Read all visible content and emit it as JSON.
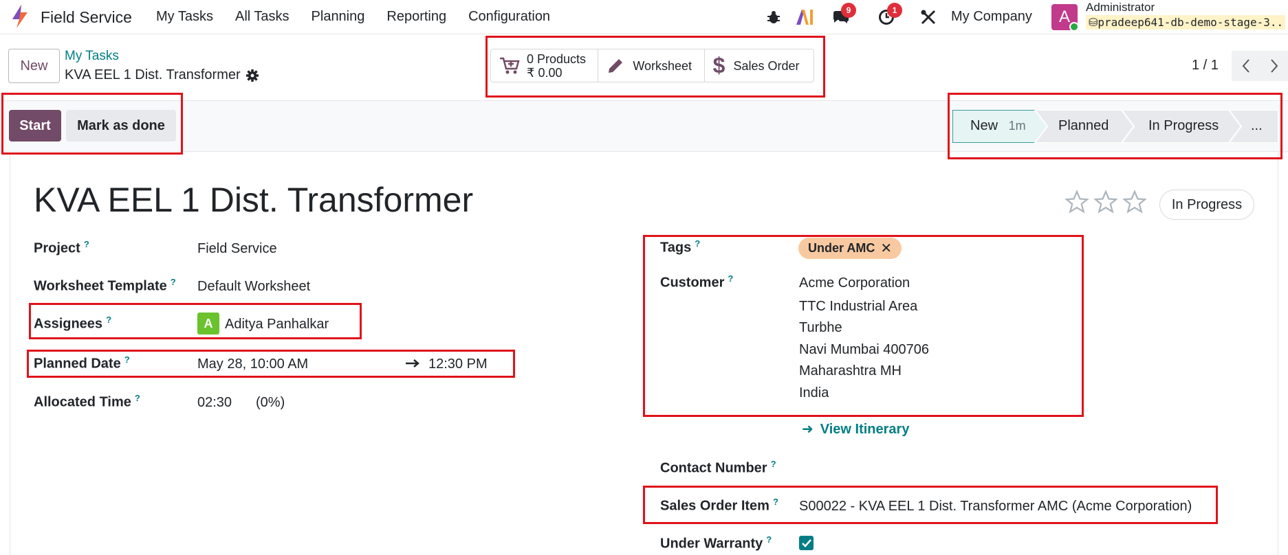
{
  "topbar": {
    "app_name": "Field Service",
    "menu": [
      "My Tasks",
      "All Tasks",
      "Planning",
      "Reporting",
      "Configuration"
    ],
    "messages_badge": "9",
    "activities_badge": "1",
    "company": "My Company",
    "avatar_letter": "A",
    "user_name": "Administrator",
    "db_name": "pradeep641-db-demo-stage-3..."
  },
  "control": {
    "new_label": "New",
    "breadcrumb": "My Tasks",
    "record_name": "KVA EEL 1 Dist. Transformer",
    "smart_buttons": {
      "products_count": "0 Products",
      "products_amount": "₹ 0.00",
      "worksheet": "Worksheet",
      "sales_order": "Sales Order"
    },
    "pager": "1 / 1"
  },
  "statusbar": {
    "start_label": "Start",
    "done_label": "Mark as done",
    "stages": [
      {
        "label": "New",
        "duration": "1m"
      },
      {
        "label": "Planned"
      },
      {
        "label": "In Progress"
      },
      {
        "label": "..."
      }
    ]
  },
  "form": {
    "title": "KVA EEL 1 Dist. Transformer",
    "state": "In Progress",
    "priority_stars": 0,
    "left": {
      "project_label": "Project",
      "project_value": "Field Service",
      "worksheet_label": "Worksheet Template",
      "worksheet_value": "Default Worksheet",
      "assignees_label": "Assignees",
      "assignee_letter": "A",
      "assignee_name": "Aditya Panhalkar",
      "planned_label": "Planned Date",
      "planned_start": "May 28, 10:00 AM",
      "planned_end": "12:30 PM",
      "allocated_label": "Allocated Time",
      "allocated_value": "02:30",
      "allocated_pct": "(0%)"
    },
    "right": {
      "tags_label": "Tags",
      "tag": "Under AMC",
      "customer_label": "Customer",
      "customer_lines": [
        "Acme Corporation",
        "TTC Industrial Area",
        "Turbhe",
        "Navi Mumbai 400706",
        "Maharashtra MH",
        "India"
      ],
      "itinerary": "View Itinerary",
      "contact_label": "Contact Number",
      "so_item_label": "Sales Order Item",
      "so_item_value": "S00022 - KVA EEL 1 Dist. Transformer AMC (Acme Corporation)",
      "warranty_label": "Under Warranty",
      "warranty_checked": true
    }
  },
  "colors": {
    "brand": "#714b67",
    "link": "#017e84",
    "highlight": "#e0121a",
    "tag_bg": "#f8c9a0"
  }
}
